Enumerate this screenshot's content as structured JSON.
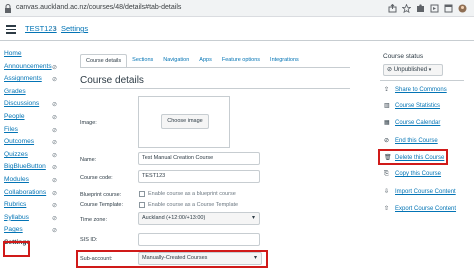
{
  "browser": {
    "url": "canvas.auckland.ac.nz/courses/48/details#tab-details"
  },
  "breadcrumb": {
    "course": "TEST123",
    "separator": "›",
    "current": "Settings"
  },
  "leftnav": {
    "items": [
      {
        "label": "Home",
        "hidden": false
      },
      {
        "label": "Announcements",
        "hidden": true
      },
      {
        "label": "Assignments",
        "hidden": true
      },
      {
        "label": "Grades",
        "hidden": false
      },
      {
        "label": "Discussions",
        "hidden": true
      },
      {
        "label": "People",
        "hidden": true
      },
      {
        "label": "Files",
        "hidden": true
      },
      {
        "label": "Outcomes",
        "hidden": true
      },
      {
        "label": "Quizzes",
        "hidden": true
      },
      {
        "label": "BigBlueButton",
        "hidden": true
      },
      {
        "label": "Modules",
        "hidden": true
      },
      {
        "label": "Collaborations",
        "hidden": true
      },
      {
        "label": "Rubrics",
        "hidden": true
      },
      {
        "label": "Syllabus",
        "hidden": true
      },
      {
        "label": "Pages",
        "hidden": true
      },
      {
        "label": "Settings",
        "hidden": false
      }
    ]
  },
  "tabs": [
    "Course details",
    "Sections",
    "Navigation",
    "Apps",
    "Feature options",
    "Integrations"
  ],
  "main": {
    "title": "Course details",
    "image_label": "Image:",
    "choose_image": "Choose image",
    "name_label": "Name:",
    "name_value": "Test Manual Creation Course",
    "code_label": "Course code:",
    "code_value": "TEST123",
    "blueprint_label": "Blueprint course:",
    "blueprint_check": "Enable course as a blueprint course",
    "template_label": "Course Template:",
    "template_check": "Enable course as a Course Template",
    "timezone_label": "Time zone:",
    "timezone_value": "Auckland (+12:00/+13:00)",
    "sisid_label": "SIS ID:",
    "subaccount_label": "Sub-account:",
    "subaccount_value": "Manually-Created Courses"
  },
  "sidebar": {
    "title": "Course status",
    "status": "Unpublished",
    "links": [
      {
        "icon": "share-icon",
        "glyph": "⇪",
        "label": "Share to Commons"
      },
      {
        "icon": "stats-icon",
        "glyph": "▥",
        "label": "Course Statistics"
      },
      {
        "icon": "calendar-icon",
        "glyph": "▦",
        "label": "Course Calendar"
      },
      {
        "icon": "end-icon",
        "glyph": "⊘",
        "label": "End this Course"
      },
      {
        "icon": "trash-icon",
        "glyph": "🗑",
        "label": "Delete this Course"
      },
      {
        "icon": "copy-icon",
        "glyph": "⎘",
        "label": "Copy this Course"
      },
      {
        "icon": "import-icon",
        "glyph": "⇩",
        "label": "Import Course Content"
      },
      {
        "icon": "export-icon",
        "glyph": "⇧",
        "label": "Export Course Content"
      }
    ]
  },
  "colors": {
    "link": "#0374b5",
    "text": "#2d3b45",
    "highlight": "#d01a19"
  }
}
